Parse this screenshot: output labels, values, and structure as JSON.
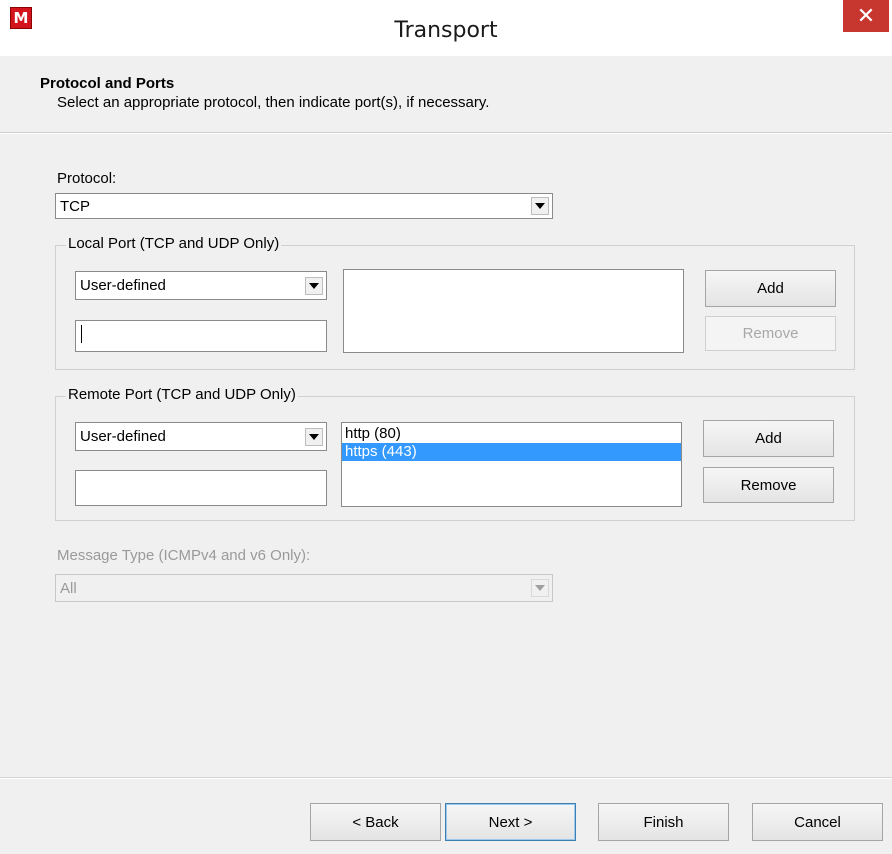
{
  "window": {
    "title": "Transport",
    "app_icon_letter": "M",
    "close_glyph": "✕"
  },
  "header": {
    "title": "Protocol and Ports",
    "subtitle": "Select an appropriate protocol, then indicate port(s), if necessary."
  },
  "protocol": {
    "label": "Protocol:",
    "value": "TCP"
  },
  "local_port": {
    "legend": "Local Port (TCP and UDP Only)",
    "type_value": "User-defined",
    "input_value": "",
    "list_items": [],
    "add_label": "Add",
    "remove_label": "Remove"
  },
  "remote_port": {
    "legend": "Remote Port (TCP and UDP Only)",
    "type_value": "User-defined",
    "input_value": "",
    "list_items": [
      "http (80)",
      "https (443)"
    ],
    "selected_index": 1,
    "add_label": "Add",
    "remove_label": "Remove"
  },
  "message_type": {
    "label": "Message Type (ICMPv4 and v6 Only):",
    "value": "All"
  },
  "footer": {
    "back_label": "< Back",
    "next_label": "Next >",
    "finish_label": "Finish",
    "cancel_label": "Cancel"
  },
  "colors": {
    "selection": "#3399ff",
    "close_button": "#c7372f",
    "app_icon": "#d4141c"
  },
  "icons": {
    "app": "mcafee-logo-icon",
    "close": "close-icon",
    "dropdown": "chevron-down-icon"
  }
}
